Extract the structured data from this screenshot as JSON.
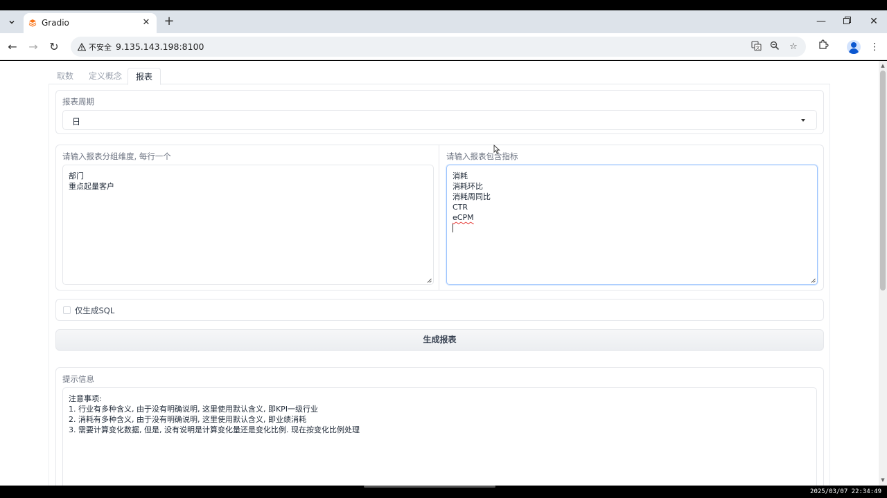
{
  "browser": {
    "tab_title": "Gradio",
    "new_tab": "+",
    "security_label": "不安全",
    "url": "9.135.143.198:8100"
  },
  "app": {
    "tabs": [
      "取数",
      "定义概念",
      "报表"
    ],
    "active_tab": "报表",
    "report_period": {
      "label": "报表周期",
      "value": "日"
    },
    "group_dims": {
      "label": "请输入报表分组维度, 每行一个",
      "lines": [
        "部门",
        "重点起量客户"
      ]
    },
    "metrics": {
      "label": "请输入报表包含指标",
      "lines": [
        "消耗",
        "消耗环比",
        "消耗周同比",
        "CTR",
        "eCPM"
      ]
    },
    "sql_only": {
      "label": "仅生成SQL",
      "checked": false
    },
    "generate_button": "生成报表",
    "hint": {
      "label": "提示信息",
      "lines": [
        "注意事项:",
        "1. 行业有多种含义, 由于没有明确说明, 这里使用默认含义, 即KPI一级行业",
        "2. 消耗有多种含义, 由于没有明确说明, 这里使用默认含义, 即业绩消耗",
        "3. 需要计算变化数据, 但是, 没有说明是计算变化量还是变化比例. 现在按变化比例处理"
      ]
    }
  },
  "taskbar": {
    "clock": "2025/03/07 22:34:49"
  },
  "colors": {
    "accent_focus": "#9ec5fe",
    "tab_strip": "#dde3ea",
    "button_bg": "#eceef1"
  }
}
